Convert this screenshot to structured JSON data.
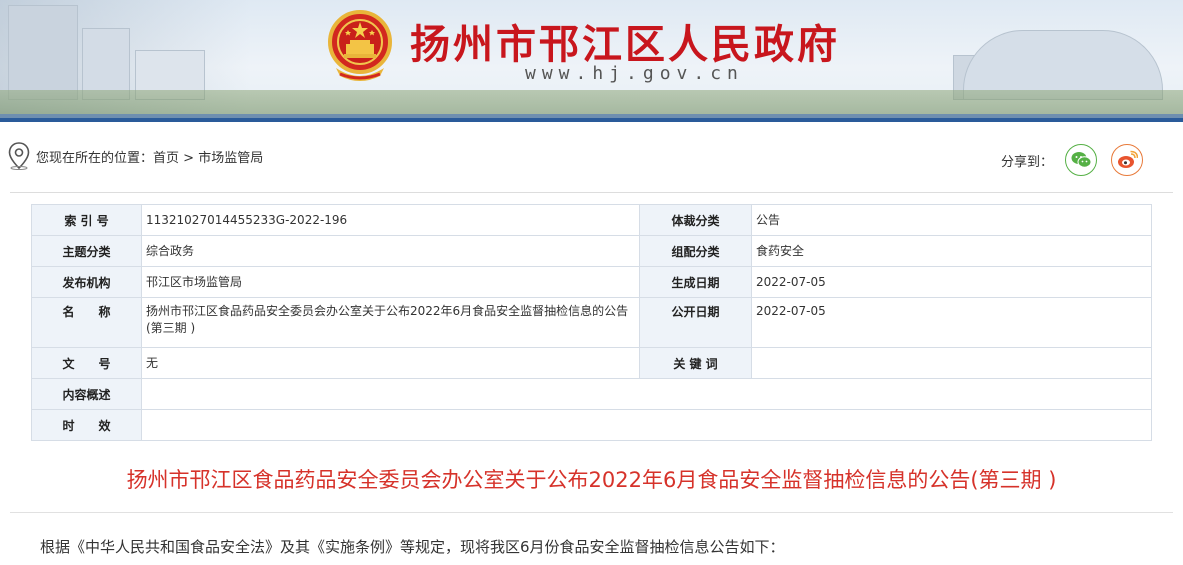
{
  "header": {
    "site_title": "扬州市邗江区人民政府",
    "site_url": "www.hj.gov.cn"
  },
  "location": {
    "prefix": "您现在所在的位置：",
    "home": "首页",
    "separator": ">",
    "current": "市场监管局"
  },
  "share": {
    "label": "分享到：",
    "wechat_icon": "wechat-icon",
    "weibo_icon": "weibo-icon"
  },
  "info": {
    "index_label": "索 引 号",
    "index_value": "11321027014455233G-2022-196",
    "genre_label": "体裁分类",
    "genre_value": "公告",
    "topic_label": "主题分类",
    "topic_value": "综合政务",
    "org_category_label": "组配分类",
    "org_category_value": "食药安全",
    "publisher_label": "发布机构",
    "publisher_value": "邗江区市场监管局",
    "created_label": "生成日期",
    "created_value": "2022-07-05",
    "name_label": "名　　称",
    "name_value": "扬州市邗江区食品药品安全委员会办公室关于公布2022年6月食品安全监督抽检信息的公告(第三期 )",
    "public_label": "公开日期",
    "public_value": "2022-07-05",
    "docno_label": "文　　号",
    "docno_value": "无",
    "keyword_label": "关 键 词",
    "keyword_value": "",
    "summary_label": "内容概述",
    "summary_value": "",
    "validity_label": "时　　效",
    "validity_value": ""
  },
  "article": {
    "title": "扬州市邗江区食品药品安全委员会办公室关于公布2022年6月食品安全监督抽检信息的公告(第三期 )",
    "body": "根据《中华人民共和国食品安全法》及其《实施条例》等规定，现将我区6月份食品安全监督抽检信息公告如下："
  },
  "colors": {
    "title_red": "#c8161d",
    "article_title_red": "#d6322a",
    "label_bg": "#eef3f9",
    "wechat_green": "#55b045",
    "weibo_orange": "#e87a3a"
  }
}
